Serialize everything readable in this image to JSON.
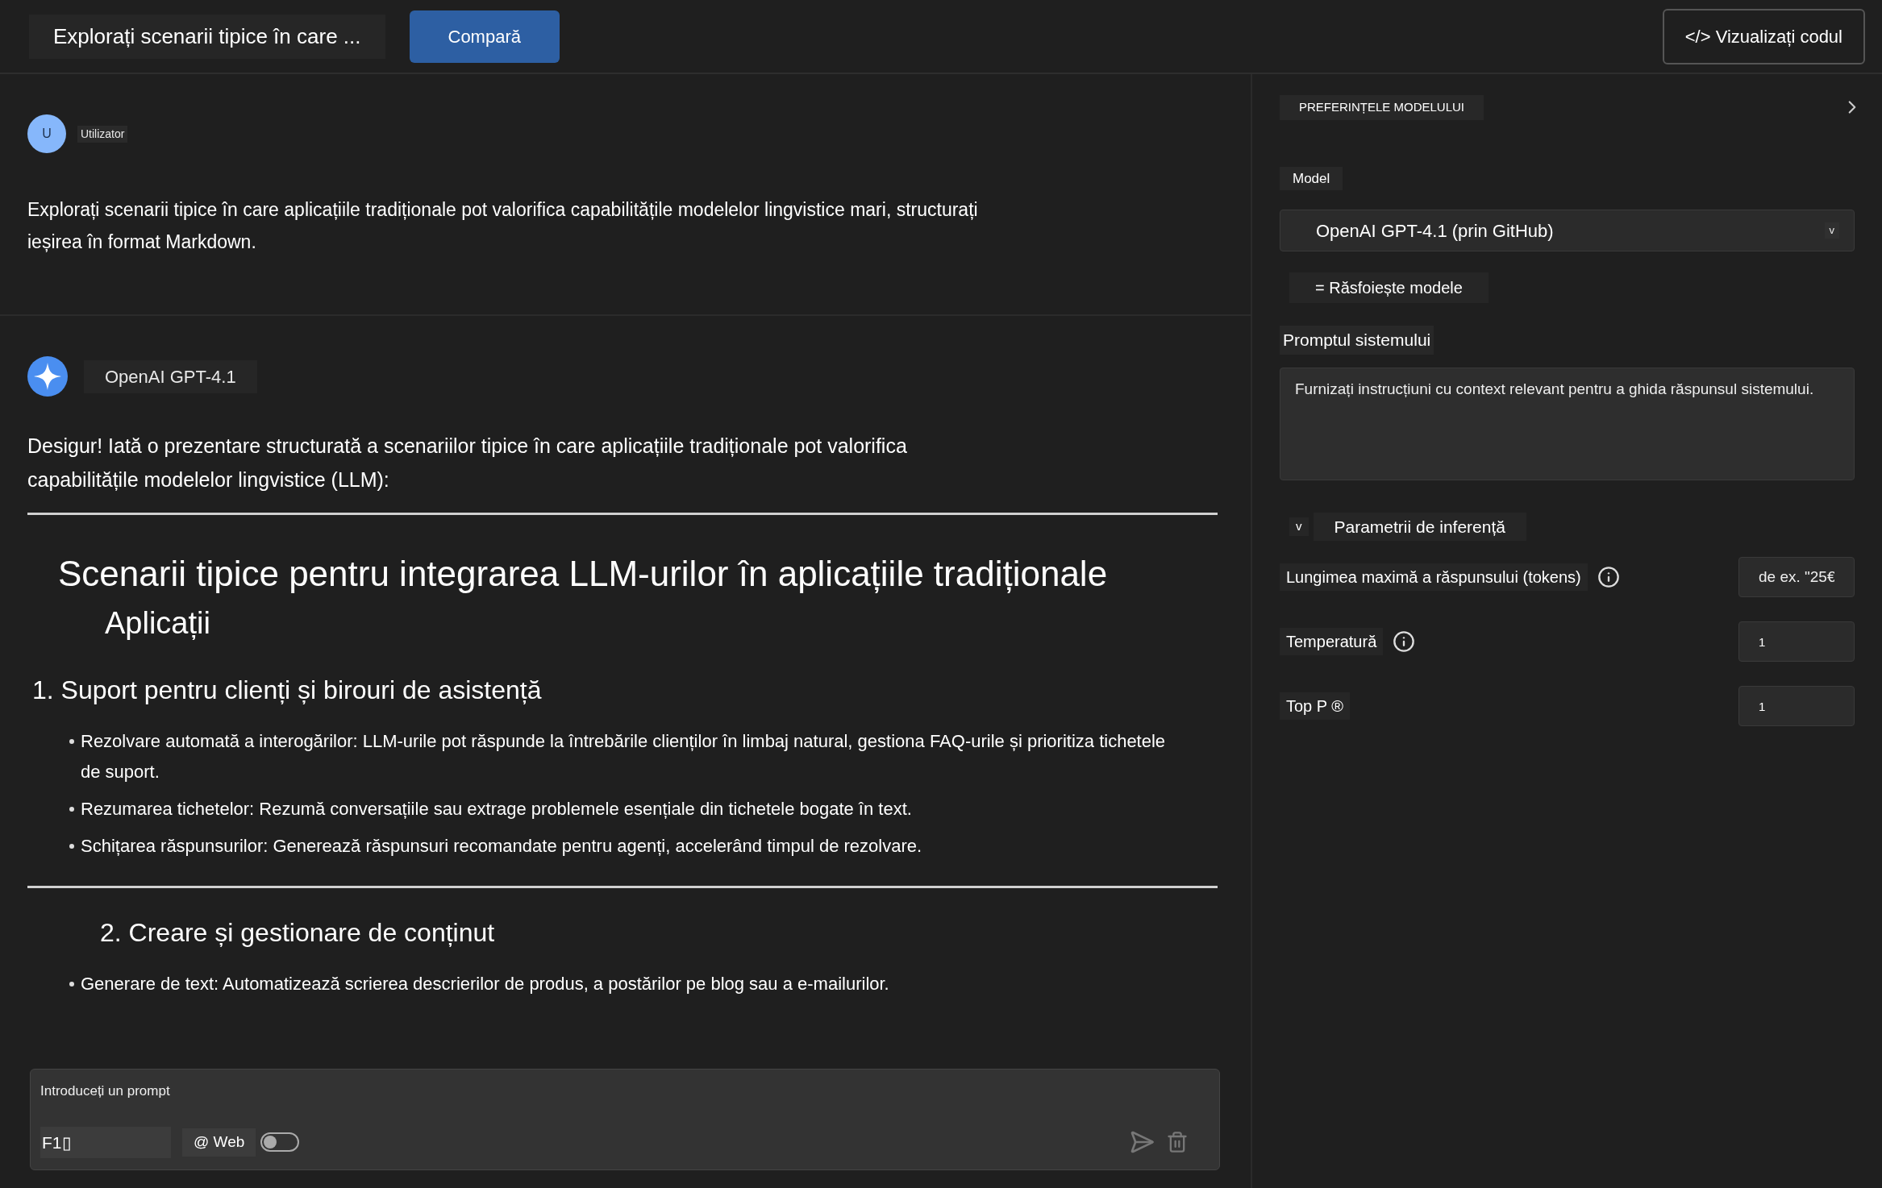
{
  "top_bar": {
    "title": "Explorați scenarii tipice în care ...",
    "compare_button": "Compară",
    "view_code_button": "</> Vizualizați codul"
  },
  "chat": {
    "user": {
      "avatar": "U",
      "name": "Utilizator",
      "message": "Explorați scenarii tipice în care aplicațiile tradiționale pot valorifica capabilitățile modelelor lingvistice mari, structurați ieșirea în format Markdown."
    },
    "assistant": {
      "name": "OpenAI GPT-4.1",
      "intro": "Desigur! Iată o prezentare structurată a scenariilor tipice în care aplicațiile tradiționale pot valorifica capabilitățile modelelor lingvistice (LLM):",
      "heading": "Scenarii tipice pentru integrarea LLM-urilor în aplicațiile tradiționale",
      "heading_cont": "Aplicații",
      "sections": [
        {
          "title": "1. Suport pentru clienți și birouri de asistență",
          "items": [
            "Rezolvare automată a interogărilor: LLM-urile pot răspunde la întrebările clienților în limbaj natural, gestiona FAQ-urile și prioritiza tichetele de suport.",
            "Rezumarea tichetelor: Rezumă conversațiile sau extrage problemele esențiale din tichetele bogate în text.",
            "Schițarea răspunsurilor: Generează răspunsuri recomandate pentru agenți, accelerând timpul de rezolvare."
          ]
        },
        {
          "title": "2. Creare și gestionare de conținut",
          "items": [
            "Generare de text: Automatizează scrierea descrierilor de produs, a postărilor pe blog sau a e-mailurilor."
          ]
        }
      ]
    }
  },
  "composer": {
    "placeholder": "Introduceți un prompt",
    "model_chip": "F1▯",
    "web_label": "@ Web",
    "web_on": false
  },
  "settings": {
    "title": "PREFERINȚELE MODELULUI",
    "model_label": "Model",
    "model_value": "OpenAI GPT-4.1 (prin GitHub)",
    "dropdown_caret": "v",
    "browse": "= Răsfoiește modele",
    "system_prompt_label": "Promptul sistemului",
    "system_prompt_placeholder": "Furnizați instrucțiuni cu context relevant pentru a ghida răspunsul sistemului.",
    "inference_toggle": "v",
    "inference_title": "Parametrii de inferență",
    "inference_expanded": true,
    "params": [
      {
        "label": "Lungimea maximă a răspunsului (tokens)",
        "info": true,
        "placeholder": "de ex. \"25€"
      },
      {
        "label": "Temperatură",
        "info": true,
        "value": "1"
      },
      {
        "label": "Top P ®",
        "info": false,
        "value": "1"
      }
    ]
  }
}
